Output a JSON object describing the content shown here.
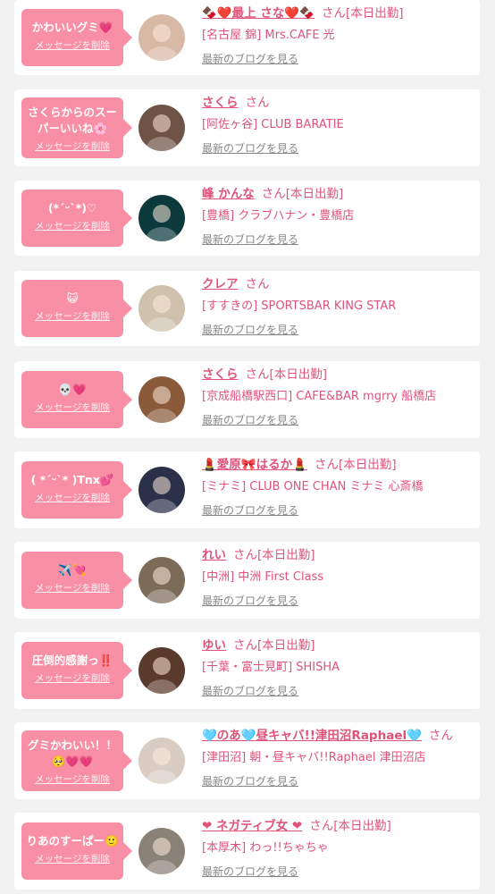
{
  "delete_label": "メッセージを削除",
  "san_label": "さん",
  "today_label": "[本日出勤]",
  "blog_label": "最新のブログを見る",
  "items": [
    {
      "message": [
        "かわいいグミ💗"
      ],
      "name": "🍫❤️最上 さな❤️🍫",
      "today": true,
      "shop": "[名古屋 錦] Mrs.CAFE 光",
      "avatar_color": "#d8b9a6"
    },
    {
      "message": [
        "さくらからのスー",
        "パーいいね🌸"
      ],
      "name": "さくら",
      "today": false,
      "shop": "[阿佐ヶ谷] CLUB BARATIE",
      "avatar_color": "#6e5346"
    },
    {
      "message": [
        "(*ˊᵕˋ*)♡"
      ],
      "name": "峰 かんな",
      "today": true,
      "shop": "[豊橋] クラブハナン・豊橋店",
      "avatar_color": "#0c3a3c"
    },
    {
      "message": [
        "😺"
      ],
      "name": "クレア",
      "today": false,
      "shop": "[すすきの] SPORTSBAR KING STAR",
      "avatar_color": "#cfc1ae"
    },
    {
      "message": [
        "💀💗"
      ],
      "name": "さくら",
      "today": true,
      "shop": "[京成船橋駅西口] CAFE&BAR mgrry 船橋店",
      "avatar_color": "#8a5a3a"
    },
    {
      "message": [
        "( *ˊᵕˋ* )Tnx💕"
      ],
      "name": "💄愛原🎀はるか💄",
      "today": true,
      "shop": "[ミナミ] CLUB ONE CHAN ミナミ 心斎橋",
      "avatar_color": "#2a3048"
    },
    {
      "message": [
        "✈️💘"
      ],
      "name": "れい",
      "today": true,
      "shop": "[中洲] 中洲 First Class",
      "avatar_color": "#7d6b5a"
    },
    {
      "message": [
        "圧倒的感謝っ‼️"
      ],
      "name": "ゆい",
      "today": true,
      "shop": "[千葉・富士見町] SHISHA",
      "avatar_color": "#5a3a2c"
    },
    {
      "message": [
        "グミかわいい！！",
        "🥺💗💗"
      ],
      "name": "🩵のあ🩵昼キャバ!!津田沼Raphael🩵",
      "today": false,
      "shop": "[津田沼] 朝・昼キャバ!!Raphael 津田沼店",
      "avatar_color": "#d9cdc3"
    },
    {
      "message": [
        "りあのすーぱー🙂"
      ],
      "name": "❤ ネガティブ女 ❤",
      "today": true,
      "shop": "[本厚木] わっ!!ちゃちゃ",
      "avatar_color": "#8a8177"
    }
  ]
}
